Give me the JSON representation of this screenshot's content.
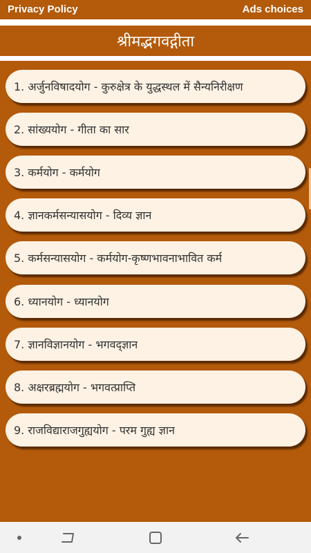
{
  "topbar": {
    "privacy_label": "Privacy Policy",
    "ads_label": "Ads choices"
  },
  "header": {
    "title": "श्रीमद्भगवद्गीता"
  },
  "chapters": [
    "1. अर्जुनविषादयोग - कुरुक्षेत्र के युद्धस्थल में सैन्यनिरीक्षण",
    "2. सांख्ययोग - गीता का सार",
    "3. कर्मयोग - कर्मयोग",
    "4. ज्ञानकर्मसन्यासयोग - दिव्य ज्ञान",
    "5. कर्मसन्यासयोग - कर्मयोग-कृष्णभावनाभावित कर्म",
    "6. ध्यानयोग - ध्यानयोग",
    "7. ज्ञानविज्ञानयोग - भगवद्ज्ञान",
    "8. अक्षरब्रह्मयोग - भगवत्प्राप्ति",
    "9. राजविद्याराजगुह्ययोग - परम गुह्य ज्ञान"
  ],
  "navbar": {
    "icons": [
      "dot-icon",
      "recent-apps-icon",
      "home-icon",
      "back-icon"
    ]
  },
  "colors": {
    "primary": "#b35a0b",
    "card": "#fdf2e4",
    "text": "#333333",
    "navbar": "#f2f2f2"
  }
}
